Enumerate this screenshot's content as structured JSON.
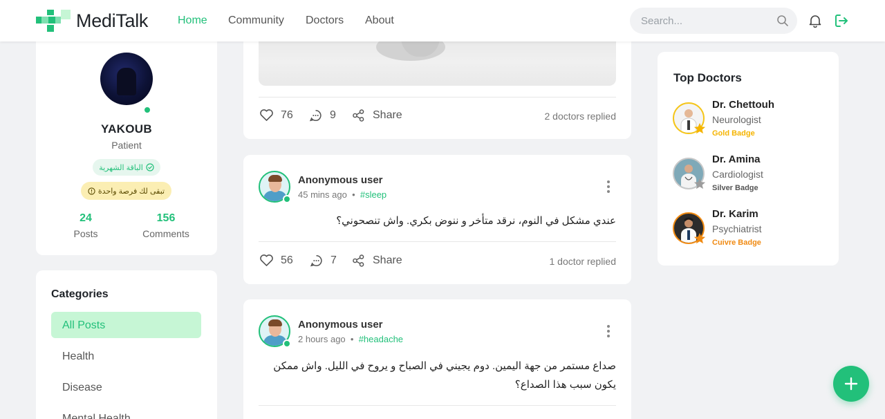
{
  "app": {
    "name": "MediTalk"
  },
  "nav": {
    "links": [
      "Home",
      "Community",
      "Doctors",
      "About"
    ],
    "search_placeholder": "Search..."
  },
  "profile": {
    "name": "YAKOUB",
    "role": "Patient",
    "plan_badge": "الباقة الشهرية",
    "remaining_badge": "تبقى لك فرصة واحدة",
    "posts_count": "24",
    "posts_label": "Posts",
    "comments_count": "156",
    "comments_label": "Comments"
  },
  "categories": {
    "title": "Categories",
    "items": [
      "All Posts",
      "Health",
      "Disease",
      "Mental Health"
    ]
  },
  "posts": [
    {
      "likes": "76",
      "comments": "9",
      "share_label": "Share",
      "replied": "2 doctors replied"
    },
    {
      "author": "Anonymous user",
      "time": "45 mins ago",
      "tag": "#sleep",
      "text": "عندي مشكل في النوم، نرقد متأخر و ننوض بكري. واش تنصحوني؟",
      "likes": "56",
      "comments": "7",
      "share_label": "Share",
      "replied": "1 doctor replied"
    },
    {
      "author": "Anonymous user",
      "time": "2 hours ago",
      "tag": "#headache",
      "text": "صداع مستمر من جهة اليمين. دوم يجيني في الصباح و يروح في الليل. واش ممكن يكون سبب هذا الصداع؟"
    }
  ],
  "top_doctors": {
    "title": "Top Doctors",
    "doctors": [
      {
        "name": "Dr. Chettouh",
        "specialty": "Neurologist",
        "badge": "Gold Badge",
        "badge_color": "#f5b400"
      },
      {
        "name": "Dr. Amina",
        "specialty": "Cardiologist",
        "badge": "Silver Badge",
        "badge_color": "#555555"
      },
      {
        "name": "Dr. Karim",
        "specialty": "Psychiatrist",
        "badge": "Cuivre Badge",
        "badge_color": "#f08a12"
      }
    ]
  },
  "colors": {
    "accent": "#22c07a"
  }
}
